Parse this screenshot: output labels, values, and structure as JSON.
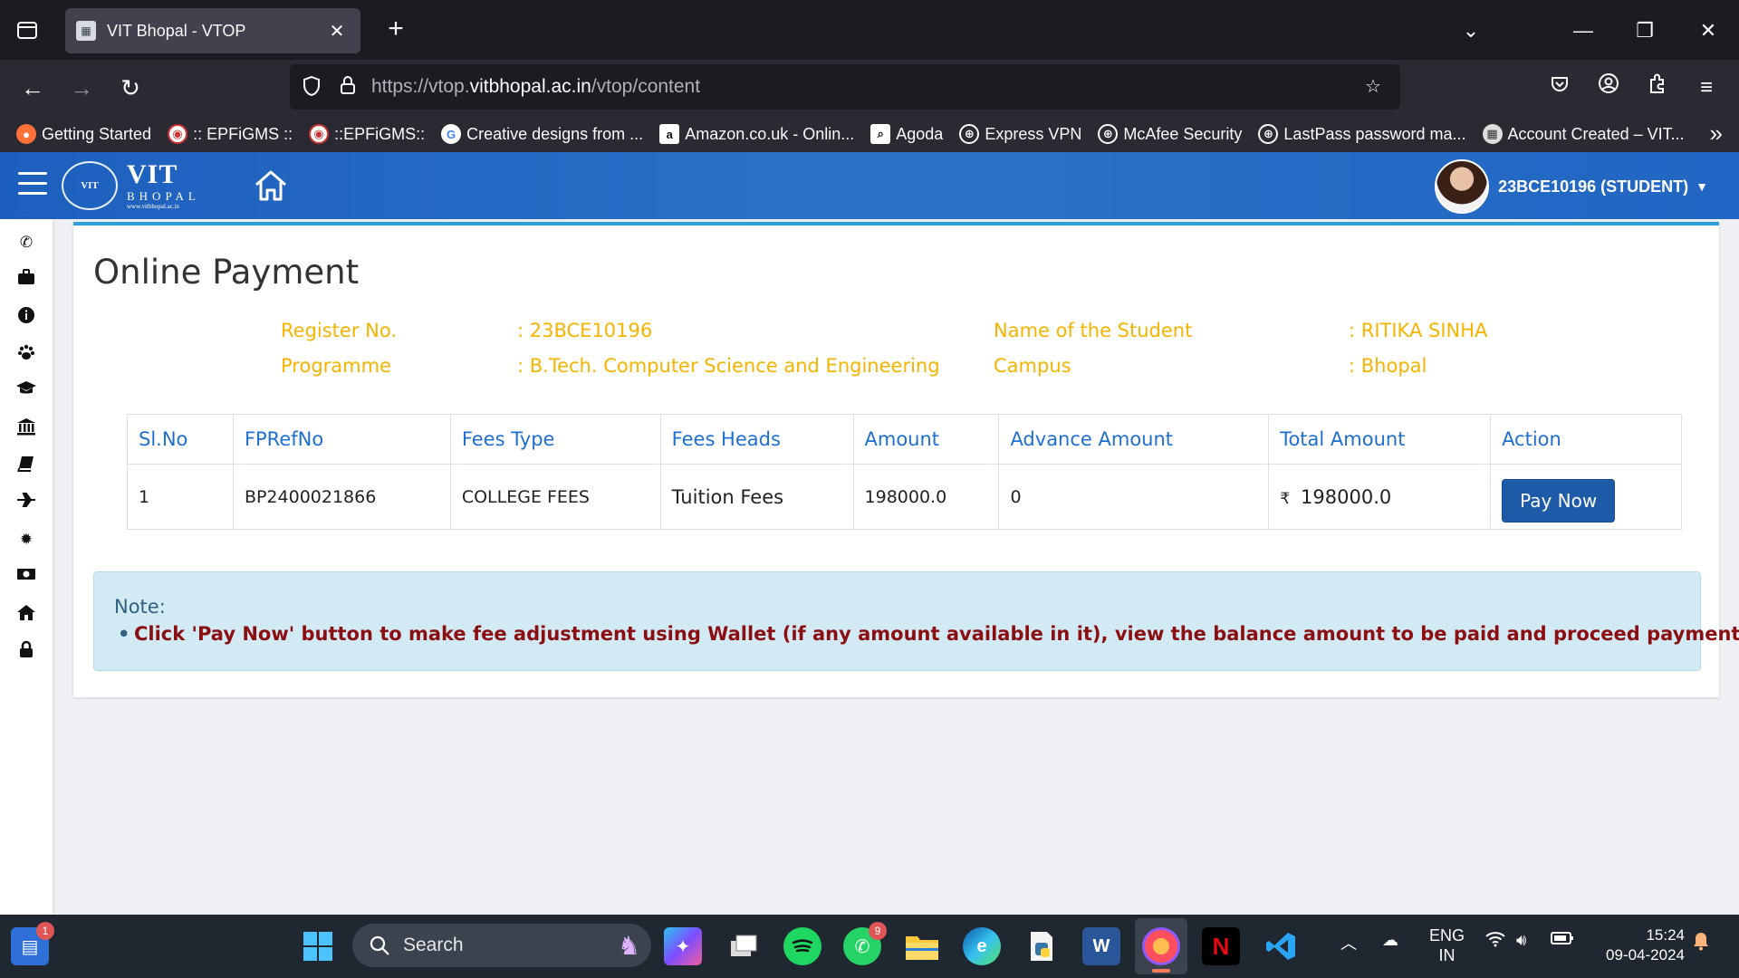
{
  "browser": {
    "tab_title": "VIT Bhopal - VTOP",
    "url_prefix": "https://vtop.",
    "url_domain": "vitbhopal.ac.in",
    "url_path": "/vtop/content",
    "bookmarks": [
      {
        "label": "Getting Started",
        "icon": "firefox-icon"
      },
      {
        "label": ":: EPFiGMS ::",
        "icon": "site-icon"
      },
      {
        "label": "::EPFiGMS::",
        "icon": "site-icon"
      },
      {
        "label": "Creative designs from ...",
        "icon": "google-icon"
      },
      {
        "label": "Amazon.co.uk - Onlin...",
        "icon": "amazon-icon"
      },
      {
        "label": "Agoda",
        "icon": "agoda-icon"
      },
      {
        "label": "Express VPN",
        "icon": "globe-icon"
      },
      {
        "label": "McAfee Security",
        "icon": "globe-icon"
      },
      {
        "label": "LastPass password ma...",
        "icon": "globe-icon"
      },
      {
        "label": "Account Created – VIT...",
        "icon": "site-icon"
      }
    ]
  },
  "header": {
    "logo_seal": "VIT",
    "logo_vit": "VIT",
    "logo_bhopal": "BHOPAL",
    "logo_url": "www.vitbhopal.ac.in",
    "user_label": "23BCE10196 (STUDENT)"
  },
  "page": {
    "title": "Online Payment",
    "info": {
      "register_label": "Register No.",
      "register_value": ": 23BCE10196",
      "name_label": "Name of the Student",
      "name_value": ": RITIKA SINHA",
      "programme_label": "Programme",
      "programme_value": ": B.Tech. Computer Science and Engineering",
      "campus_label": "Campus",
      "campus_value": ": Bhopal"
    },
    "table": {
      "headers": [
        "Sl.No",
        "FPRefNo",
        "Fees Type",
        "Fees Heads",
        "Amount",
        "Advance Amount",
        "Total Amount",
        "Action"
      ],
      "rows": [
        {
          "sl_no": "1",
          "fp_ref_no": "BP2400021866",
          "fees_type": "COLLEGE FEES",
          "fees_heads": "Tuition Fees",
          "amount": "198000.0",
          "advance_amount": "0",
          "currency": "₹",
          "total_amount": "198000.0",
          "action_label": "Pay Now"
        }
      ]
    },
    "note": {
      "title": "Note:",
      "item": "Click 'Pay Now' button to make fee adjustment using Wallet (if any amount available in it), view the balance amount to be paid and proceed payment"
    }
  },
  "taskbar": {
    "search_label": "Search",
    "widget_badge": "1",
    "whatsapp_badge": "9",
    "lang_line1": "ENG",
    "lang_line2": "IN",
    "time": "15:24",
    "date": "09-04-2024"
  },
  "colors": {
    "header_blue": "#1d5fbd",
    "accent_yellow": "#f5b400",
    "table_header_blue": "#1f6fd0",
    "note_red": "#8b0f12",
    "button_blue": "#1d5aa8"
  }
}
